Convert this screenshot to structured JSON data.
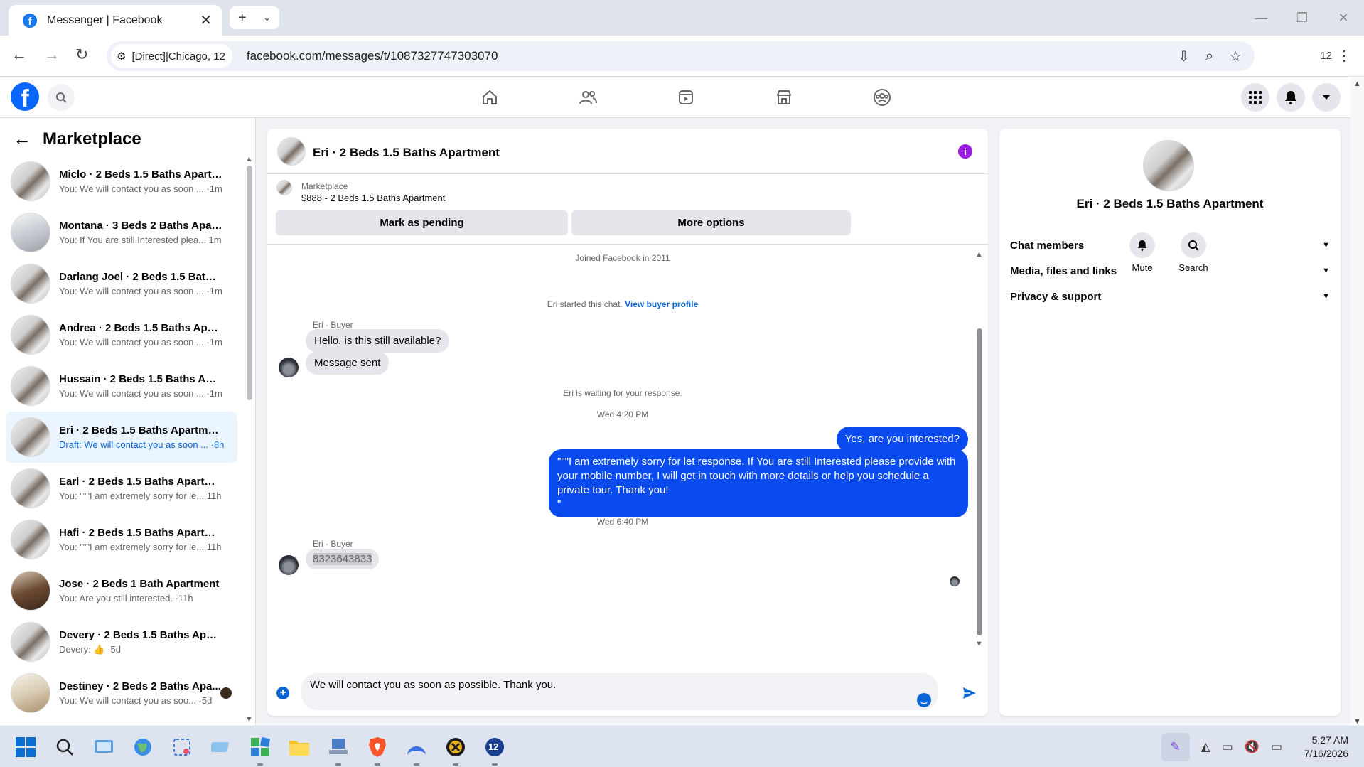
{
  "browser": {
    "tab_title": "Messenger | Facebook",
    "site_chip": "[Direct]|Chicago, 12",
    "url": "facebook.com/messages/t/1087327747303070",
    "ext_count": "12"
  },
  "sidebar": {
    "title": "Marketplace",
    "conversations": [
      {
        "name": "Miclo · 2 Beds 1.5 Baths Apartm...",
        "preview": "You: We will contact you as soon ... ·1m"
      },
      {
        "name": "Montana · 3 Beds 2 Baths Apart...",
        "preview": "You: If You are still Interested plea... 1m"
      },
      {
        "name": "Darlang Joel · 2 Beds 1.5 Baths ...",
        "preview": "You: We will contact you as soon ... ·1m"
      },
      {
        "name": "Andrea · 2 Beds 1.5 Baths Apart...",
        "preview": "You: We will contact you as soon ... ·1m"
      },
      {
        "name": "Hussain · 2 Beds 1.5 Baths Apart...",
        "preview": "You: We will contact you as soon ... ·1m"
      },
      {
        "name": "Eri · 2 Beds 1.5 Baths Apartment",
        "preview": "Draft: We will contact you as soon ... ·8h"
      },
      {
        "name": "Earl · 2 Beds 1.5 Baths Apartment",
        "preview": "You: \"\"\"I am extremely sorry for le... 11h"
      },
      {
        "name": "Hafi · 2 Beds 1.5 Baths Apartment",
        "preview": "You: \"\"\"I am extremely sorry for le... 11h"
      },
      {
        "name": "Jose · 2 Beds 1 Bath Apartment",
        "preview": "You: Are you still interested. ·11h"
      },
      {
        "name": "Devery · 2 Beds 1.5 Baths Apart...",
        "preview": "Devery: 👍 ·5d"
      },
      {
        "name": "Destiney · 2 Beds 2 Baths Apa...",
        "preview": "You: We will contact you as soo... ·5d"
      }
    ]
  },
  "chat": {
    "header_name": "Eri · 2 Beds 1.5 Baths Apartment",
    "marketplace_label": "Marketplace",
    "listing": "$888 - 2 Beds 1.5 Baths Apartment",
    "mark_pending": "Mark as pending",
    "more_options": "More options",
    "joined": "Joined Facebook in 2011",
    "started_text": "Eri started this chat.",
    "view_profile": "View buyer profile",
    "sender_label": "Eri · Buyer",
    "msg_available": "Hello, is this still available?",
    "msg_sent": "Message sent",
    "waiting": "Eri is waiting for your response.",
    "time1": "Wed 4:20 PM",
    "out1": "Yes, are you interested?",
    "out2": "\"\"\"I am extremely sorry for let response. If You are still Interested please provide with your mobile number, I will get in touch with more details or help you schedule a private tour. Thank you!\n\"",
    "time2": "Wed 6:40 PM",
    "phone_msg": "8323643833",
    "draft": "We will contact you as soon as possible. Thank you."
  },
  "info_panel": {
    "name": "Eri · 2 Beds 1.5 Baths Apartment",
    "mute": "Mute",
    "search": "Search",
    "sections": [
      "Chat members",
      "Media, files and links",
      "Privacy & support"
    ]
  },
  "taskbar": {
    "time": "5:27 AM",
    "date": "7/16/2026",
    "badge": "12"
  },
  "colors": {
    "accent": "#0a66d4",
    "outgoing_bubble": "#0a4bf0",
    "info_icon": "#9b1ee0"
  }
}
